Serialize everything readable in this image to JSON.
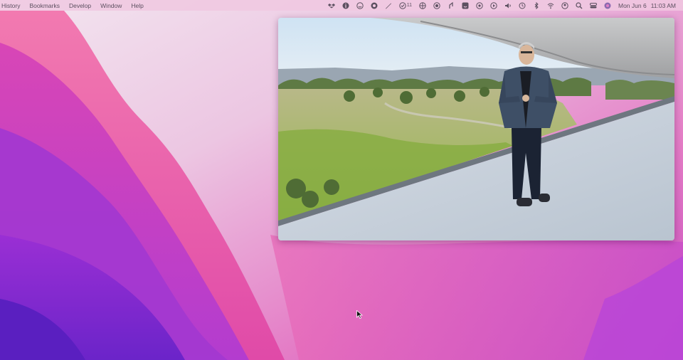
{
  "menu": {
    "items": [
      "History",
      "Bookmarks",
      "Develop",
      "Window",
      "Help"
    ]
  },
  "status": {
    "icons": [
      "dropbox-icon",
      "info-icon",
      "face-icon",
      "github-icon",
      "pen-icon",
      "check-icon",
      "grid-icon",
      "record-icon",
      "share-icon",
      "finder-icon",
      "rec-icon",
      "play-icon",
      "volume-icon",
      "history-icon",
      "bluetooth-icon",
      "wifi-icon",
      "user-icon",
      "search-icon",
      "control-center-icon",
      "siri-icon"
    ],
    "check_count": "11",
    "date": "Mon Jun 6",
    "time": "11:03 AM"
  },
  "colors": {
    "menubar": "#f0c8e1",
    "wallpaper_pink": "#e15fb8",
    "wallpaper_purple": "#7a2bd6"
  }
}
